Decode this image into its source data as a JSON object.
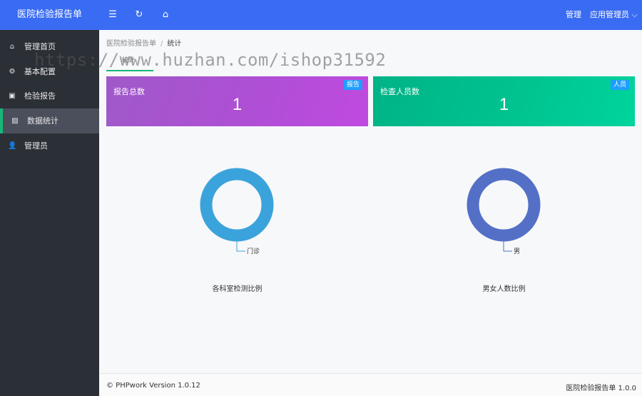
{
  "header": {
    "logo_text": "医院检验报告单",
    "right_link": "管理",
    "user_menu": "应用管理员 ⌵"
  },
  "icons": {
    "menu": "☰",
    "refresh": "↻",
    "home": "⌂"
  },
  "sidebar": {
    "items": [
      {
        "label": "管理首页",
        "icon": "⌂",
        "active": false
      },
      {
        "label": "基本配置",
        "icon": "⚙",
        "active": false
      },
      {
        "label": "检验报告",
        "icon": "▣",
        "active": false
      },
      {
        "label": "数据统计",
        "icon": "▨",
        "active": true
      },
      {
        "label": "管理员",
        "icon": "👤",
        "active": false
      }
    ]
  },
  "breadcrumb": {
    "root": "医院检验报告单",
    "separator": "/",
    "current": "统计"
  },
  "tab": {
    "label": "统计"
  },
  "cards": [
    {
      "title": "报告总数",
      "value": "1",
      "badge": "报告",
      "color": "#b04ed6"
    },
    {
      "title": "检查人员数",
      "value": "1",
      "badge": "人员",
      "color": "#00c591"
    }
  ],
  "charts": [
    {
      "title": "各科室检测比例",
      "label": "门诊",
      "color": "#3ba3db"
    },
    {
      "title": "男女人数比例",
      "label": "男",
      "color": "#5470c6"
    }
  ],
  "chart_data": [
    {
      "type": "pie",
      "title": "各科室检测比例",
      "categories": [
        "门诊"
      ],
      "values": [
        1
      ]
    },
    {
      "type": "pie",
      "title": "男女人数比例",
      "categories": [
        "男"
      ],
      "values": [
        1
      ]
    }
  ],
  "footer": {
    "left": "© PHPwork Version 1.0.12",
    "right": "医院检验报告单 1.0.0"
  },
  "watermark": "https://www.huzhan.com/ishop31592"
}
